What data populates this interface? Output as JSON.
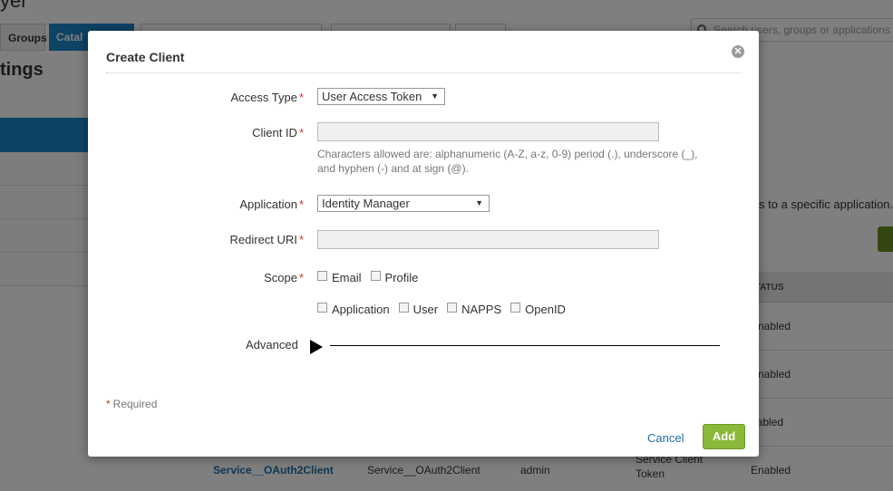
{
  "background": {
    "brand_fragment": "yer",
    "tabs": [
      "Groups",
      "Catal"
    ],
    "search_placeholder": "Search users, groups or applications",
    "heading": "tings",
    "description_fragment": "s to a specific application.",
    "table": {
      "status_header": "STATUS",
      "rows": [
        {
          "status": "Enabled"
        },
        {
          "status": "Enabled"
        },
        {
          "status": "nabled"
        },
        {
          "name": "Service__OAuth2Client",
          "description": "Service__OAuth2Client",
          "owner": "admin",
          "type_line1": "Service Client",
          "type_line2": "Token",
          "status": "Enabled"
        }
      ]
    }
  },
  "modal": {
    "title": "Create Client",
    "close_glyph": "✕",
    "access_type": {
      "label": "Access Type",
      "value": "User Access Token"
    },
    "client_id": {
      "label": "Client ID",
      "value": "",
      "help_line1": "Characters allowed are: alphanumeric (A-Z, a-z, 0-9) period (.), underscore (_),",
      "help_line2": "and hyphen (-) and at sign (@)."
    },
    "application": {
      "label": "Application",
      "value": "Identity Manager"
    },
    "redirect_uri": {
      "label": "Redirect URI",
      "value": ""
    },
    "scope": {
      "label": "Scope",
      "row1": [
        "Email",
        "Profile"
      ],
      "row2": [
        "Application",
        "User",
        "NAPPS",
        "OpenID"
      ]
    },
    "advanced_label": "Advanced",
    "required_marker": "*",
    "required_note": "Required",
    "cancel_label": "Cancel",
    "add_label": "Add"
  },
  "colors": {
    "accent_blue": "#1b87c9",
    "add_green": "#8ab838",
    "required_red": "#c0392b"
  }
}
